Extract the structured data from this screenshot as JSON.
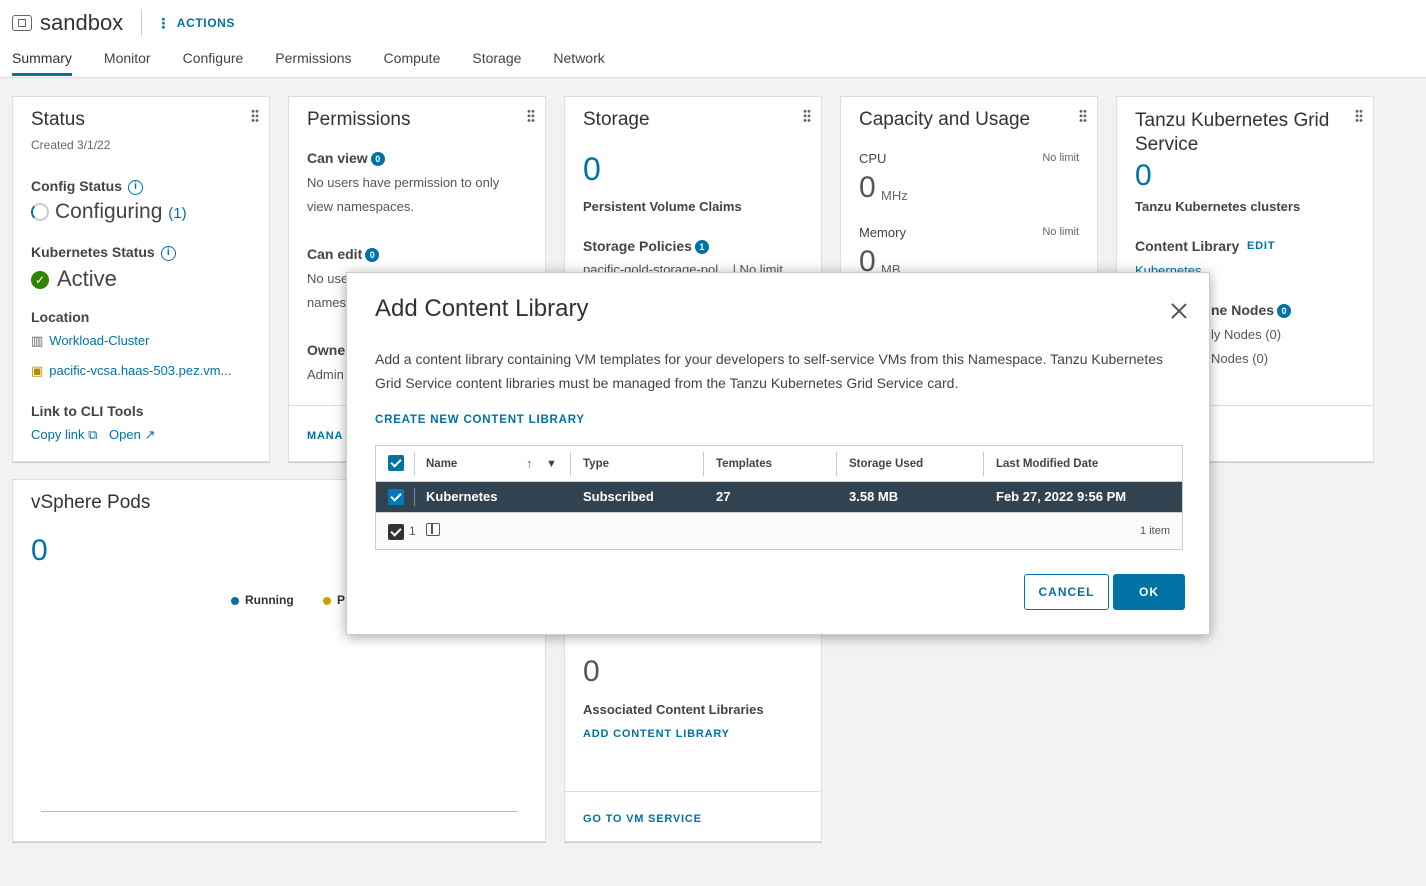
{
  "header": {
    "title": "sandbox",
    "actions_label": "ACTIONS",
    "tabs": [
      "Summary",
      "Monitor",
      "Configure",
      "Permissions",
      "Compute",
      "Storage",
      "Network"
    ]
  },
  "status_card": {
    "title": "Status",
    "created": "Created 3/1/22",
    "config_status_label": "Config Status",
    "config_status_value": "Configuring",
    "config_count": "(1)",
    "k8s_status_label": "Kubernetes Status",
    "k8s_status_value": "Active",
    "location_label": "Location",
    "cluster_link": "Workload-Cluster",
    "vcsa_link": "pacific-vcsa.haas-503.pez.vm...",
    "cli_label": "Link to CLI Tools",
    "copy_link": "Copy link",
    "open_link": "Open"
  },
  "permissions_card": {
    "title": "Permissions",
    "can_view_label": "Can view",
    "can_view_count": "0",
    "can_view_text_1": "No users have permission to only",
    "can_view_text_2": "view namespaces.",
    "can_edit_label": "Can edit",
    "can_edit_count": "0",
    "can_edit_text_1": "No use",
    "can_edit_text_2": "names",
    "owner_label": "Owne",
    "owner_text": "Admin",
    "footer_link": "MANA"
  },
  "storage_card": {
    "title": "Storage",
    "pvc_count": "0",
    "pvc_label": "Persistent Volume Claims",
    "policies_label": "Storage Policies",
    "policies_count": "1",
    "policy_row": "pacific-gold-storage-pol...  |  No limit"
  },
  "capacity_card": {
    "title": "Capacity and Usage",
    "cpu_label": "CPU",
    "cpu_limit": "No limit",
    "cpu_value": "0",
    "cpu_unit": "MHz",
    "mem_label": "Memory",
    "mem_limit": "No limit",
    "mem_value": "0",
    "mem_unit": "MB"
  },
  "tkg_card": {
    "title_1": "Tanzu Kubernetes Grid",
    "title_2": "Service",
    "count": "0",
    "clusters_label": "Tanzu Kubernetes clusters",
    "content_library_label": "Content Library",
    "edit_link": "EDIT",
    "library_link": "Kubernetes",
    "control_nodes_label": "ne Nodes",
    "control_nodes_count": "0",
    "ready_nodes": "ly Nodes (0)",
    "other_nodes": "Nodes (0)"
  },
  "pods_card": {
    "title": "vSphere Pods",
    "count": "0",
    "legend_running": "Running",
    "legend_pending": "P"
  },
  "vm_service_card": {
    "count": "0",
    "assoc_label": "Associated Content Libraries",
    "add_link": "ADD CONTENT LIBRARY",
    "footer_link": "GO TO VM SERVICE"
  },
  "modal": {
    "title": "Add Content Library",
    "description": "Add a content library containing VM templates for your developers to self-service VMs from this Namespace. Tanzu Kubernetes Grid Service content libraries must be managed from the Tanzu Kubernetes Grid Service card.",
    "create_link": "CREATE NEW CONTENT LIBRARY",
    "columns": [
      "Name",
      "Type",
      "Templates",
      "Storage Used",
      "Last Modified Date"
    ],
    "rows": [
      {
        "name": "Kubernetes",
        "type": "Subscribed",
        "templates": "27",
        "storage_used": "3.58 MB",
        "modified": "Feb 27, 2022 9:56 PM"
      }
    ],
    "selected_count": "1",
    "item_count": "1 item",
    "cancel_label": "CANCEL",
    "ok_label": "OK"
  },
  "colors": {
    "accent": "#0072a3",
    "active_green": "#2f8400",
    "selected_row": "#314351"
  }
}
